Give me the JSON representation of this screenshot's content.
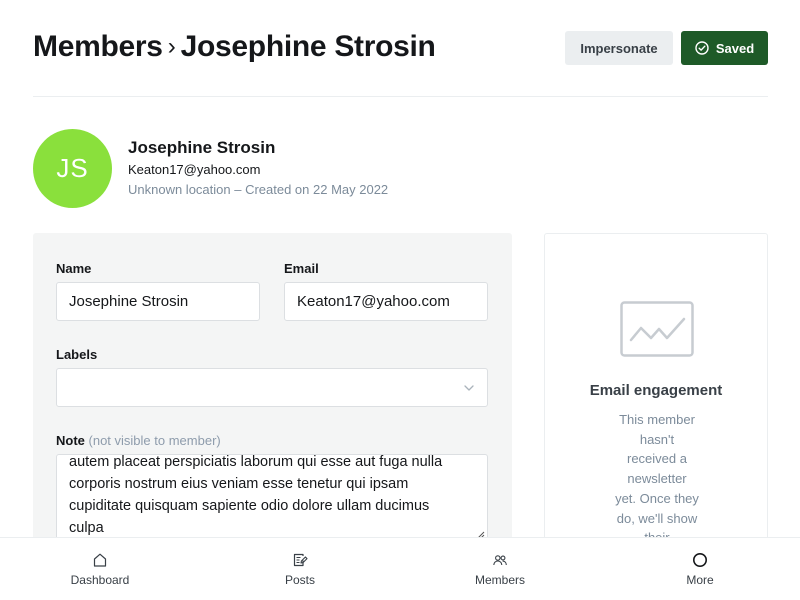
{
  "header": {
    "breadcrumb_parent": "Members",
    "breadcrumb_current": "Josephine Strosin",
    "impersonate_label": "Impersonate",
    "saved_label": "Saved"
  },
  "member": {
    "initials": "JS",
    "name": "Josephine Strosin",
    "email": "Keaton17@yahoo.com",
    "meta": "Unknown location – Created on 22 May 2022",
    "avatar_color": "#8ae03c"
  },
  "form": {
    "name_label": "Name",
    "name_value": "Josephine Strosin",
    "email_label": "Email",
    "email_value": "Keaton17@yahoo.com",
    "labels_label": "Labels",
    "labels_value": "",
    "note_label": "Note",
    "note_hint": "(not visible to member)",
    "note_lines": [
      "autem placeat perspiciatis laborum qui esse aut fuga nulla",
      "corporis nostrum eius veniam esse tenetur qui ipsam",
      "cupiditate quisquam sapiente odio dolore ullam ducimus",
      "culpa"
    ]
  },
  "engagement": {
    "title": "Email engagement",
    "desc_lines": [
      "This member",
      "hasn't",
      "received a",
      "newsletter",
      "yet. Once they",
      "do, we'll show",
      "their"
    ],
    "icon": "activity-chart-icon"
  },
  "nav": {
    "items": [
      {
        "label": "Dashboard",
        "icon": "home-icon"
      },
      {
        "label": "Posts",
        "icon": "posts-icon"
      },
      {
        "label": "Members",
        "icon": "members-icon"
      },
      {
        "label": "More",
        "icon": "more-icon"
      }
    ]
  },
  "colors": {
    "saved_button": "#1e5a28",
    "impersonate_button": "#ebeef0",
    "form_panel": "#f4f5f5",
    "muted_text": "#7c8b9a"
  }
}
